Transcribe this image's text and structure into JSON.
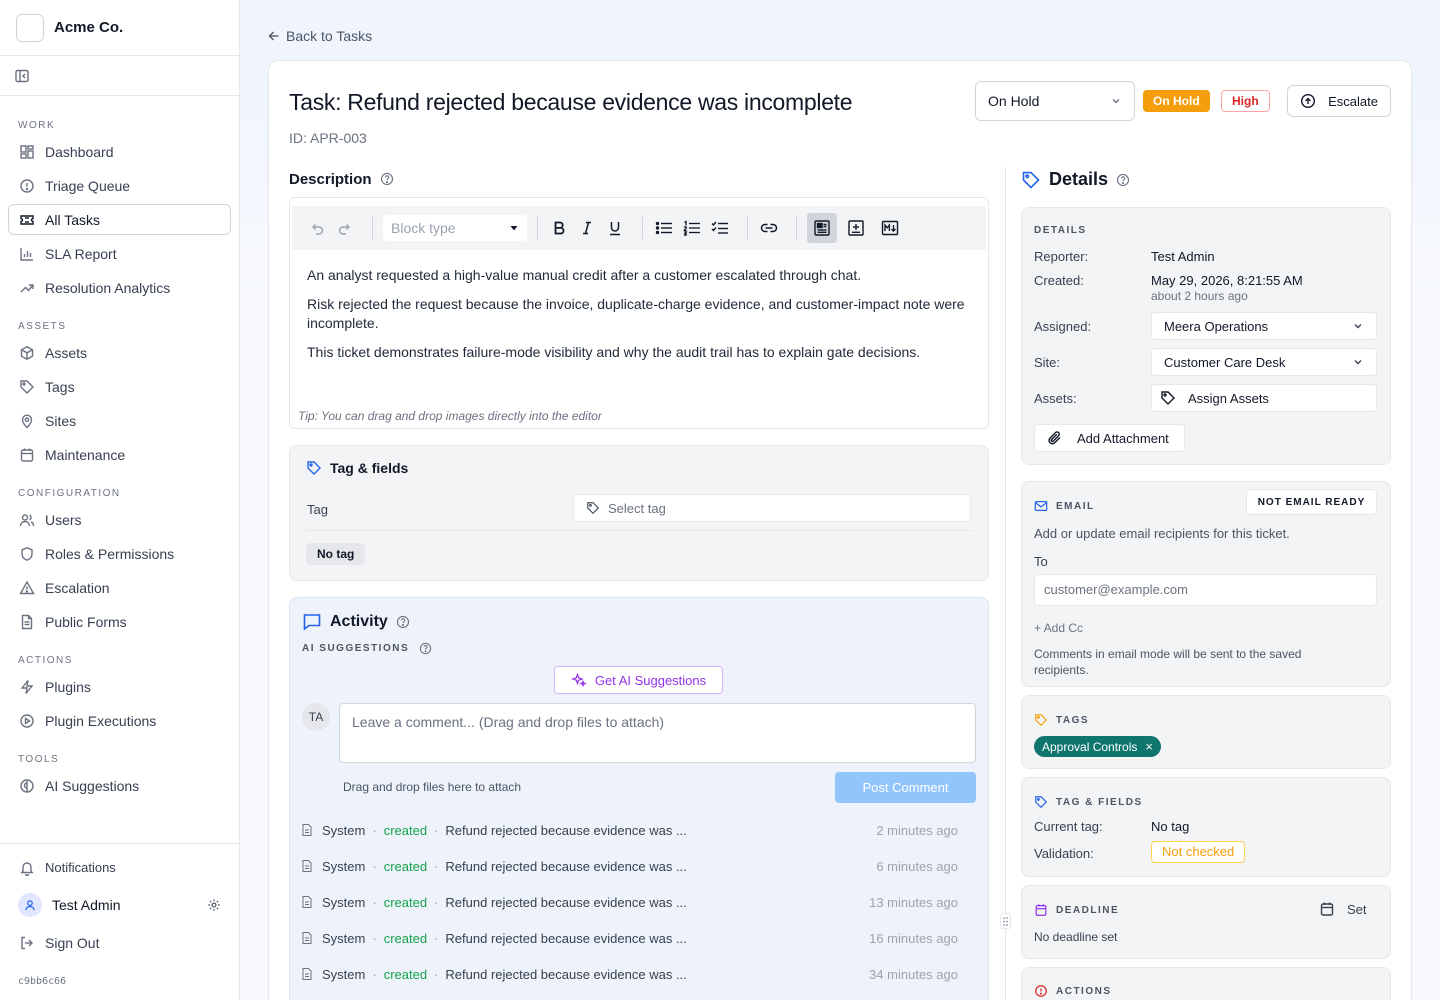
{
  "brand": {
    "name": "Acme Co."
  },
  "sidebar": {
    "sections": [
      {
        "label": "WORK",
        "items": [
          {
            "label": "Dashboard",
            "icon": "grid-icon"
          },
          {
            "label": "Triage Queue",
            "icon": "alert-circle-icon"
          },
          {
            "label": "All Tasks",
            "icon": "ticket-icon",
            "active": true
          },
          {
            "label": "SLA Report",
            "icon": "bar-chart-icon"
          },
          {
            "label": "Resolution Analytics",
            "icon": "trending-up-icon"
          }
        ]
      },
      {
        "label": "ASSETS",
        "items": [
          {
            "label": "Assets",
            "icon": "package-icon"
          },
          {
            "label": "Tags",
            "icon": "tag-icon"
          },
          {
            "label": "Sites",
            "icon": "map-pin-icon"
          },
          {
            "label": "Maintenance",
            "icon": "calendar-icon"
          }
        ]
      },
      {
        "label": "CONFIGURATION",
        "items": [
          {
            "label": "Users",
            "icon": "users-icon"
          },
          {
            "label": "Roles & Permissions",
            "icon": "shield-icon"
          },
          {
            "label": "Escalation",
            "icon": "warning-triangle-icon"
          },
          {
            "label": "Public Forms",
            "icon": "file-text-icon"
          }
        ]
      },
      {
        "label": "ACTIONS",
        "items": [
          {
            "label": "Plugins",
            "icon": "zap-icon"
          },
          {
            "label": "Plugin Executions",
            "icon": "play-circle-icon"
          }
        ]
      },
      {
        "label": "TOOLS",
        "items": [
          {
            "label": "AI Suggestions",
            "icon": "brain-icon"
          }
        ]
      }
    ],
    "notifications_label": "Notifications",
    "user_name": "Test Admin",
    "sign_out_label": "Sign Out",
    "version": "c9bb6c66"
  },
  "back_label": "Back to Tasks",
  "task": {
    "title": "Task: Refund rejected because evidence was incomplete",
    "id_label": "ID: APR-003",
    "status_value": "On Hold",
    "status_badge": "On Hold",
    "priority_badge": "High",
    "escalate_label": "Escalate"
  },
  "description": {
    "heading": "Description",
    "block_type_placeholder": "Block type",
    "paragraphs": [
      "An analyst requested a high-value manual credit after a customer escalated through chat.",
      "Risk rejected the request because the invoice, duplicate-charge evidence, and customer-impact note were incomplete.",
      "This ticket demonstrates failure-mode visibility and why the audit trail has to explain gate decisions."
    ],
    "tip": "Tip: You can drag and drop images directly into the editor"
  },
  "tag_fields": {
    "heading": "Tag & fields",
    "tag_label": "Tag",
    "select_placeholder": "Select tag",
    "no_tag_badge": "No tag"
  },
  "activity": {
    "heading": "Activity",
    "ai_caption": "AI SUGGESTIONS",
    "ai_button": "Get AI Suggestions",
    "avatar_initials": "TA",
    "comment_placeholder": "Leave a comment... (Drag and drop files to attach)",
    "drop_hint": "Drag and drop files here to attach",
    "post_button": "Post Comment",
    "entries": [
      {
        "who": "System",
        "verb": "created",
        "what": "Refund rejected because evidence was ...",
        "when": "2 minutes ago"
      },
      {
        "who": "System",
        "verb": "created",
        "what": "Refund rejected because evidence was ...",
        "when": "6 minutes ago"
      },
      {
        "who": "System",
        "verb": "created",
        "what": "Refund rejected because evidence was ...",
        "when": "13 minutes ago"
      },
      {
        "who": "System",
        "verb": "created",
        "what": "Refund rejected because evidence was ...",
        "when": "16 minutes ago"
      },
      {
        "who": "System",
        "verb": "created",
        "what": "Refund rejected because evidence was ...",
        "when": "34 minutes ago"
      }
    ]
  },
  "details": {
    "heading": "Details",
    "caption": "DETAILS",
    "reporter_label": "Reporter:",
    "reporter": "Test Admin",
    "created_label": "Created:",
    "created": "May 29, 2026, 8:21:55 AM",
    "created_relative": "about 2 hours ago",
    "assigned_label": "Assigned:",
    "assigned": "Meera Operations",
    "site_label": "Site:",
    "site": "Customer Care Desk",
    "assets_label": "Assets:",
    "assets_button": "Assign Assets",
    "attachment_button": "Add Attachment"
  },
  "email": {
    "caption": "EMAIL",
    "status_button": "NOT EMAIL READY",
    "description": "Add or update email recipients for this ticket.",
    "to_label": "To",
    "to_placeholder": "customer@example.com",
    "add_cc": "+ Add Cc",
    "note": "Comments in email mode will be sent to the saved recipients."
  },
  "tags": {
    "caption": "TAGS",
    "chip": "Approval Controls",
    "chip_remove": "×"
  },
  "tag_fields_summary": {
    "caption": "TAG & FIELDS",
    "current_label": "Current tag:",
    "current": "No tag",
    "validation_label": "Validation:",
    "validation": "Not checked"
  },
  "deadline": {
    "caption": "DEADLINE",
    "set_label": "Set",
    "value": "No deadline set"
  },
  "actions": {
    "caption": "ACTIONS"
  },
  "colors": {
    "accent": "#2563eb",
    "on_hold": "#f59e0b",
    "high": "#dc2626",
    "created_verb": "#16a34a",
    "tag_chip": "#0f766e",
    "ai_purple": "#9333ea",
    "post_button": "#93c5fd"
  }
}
